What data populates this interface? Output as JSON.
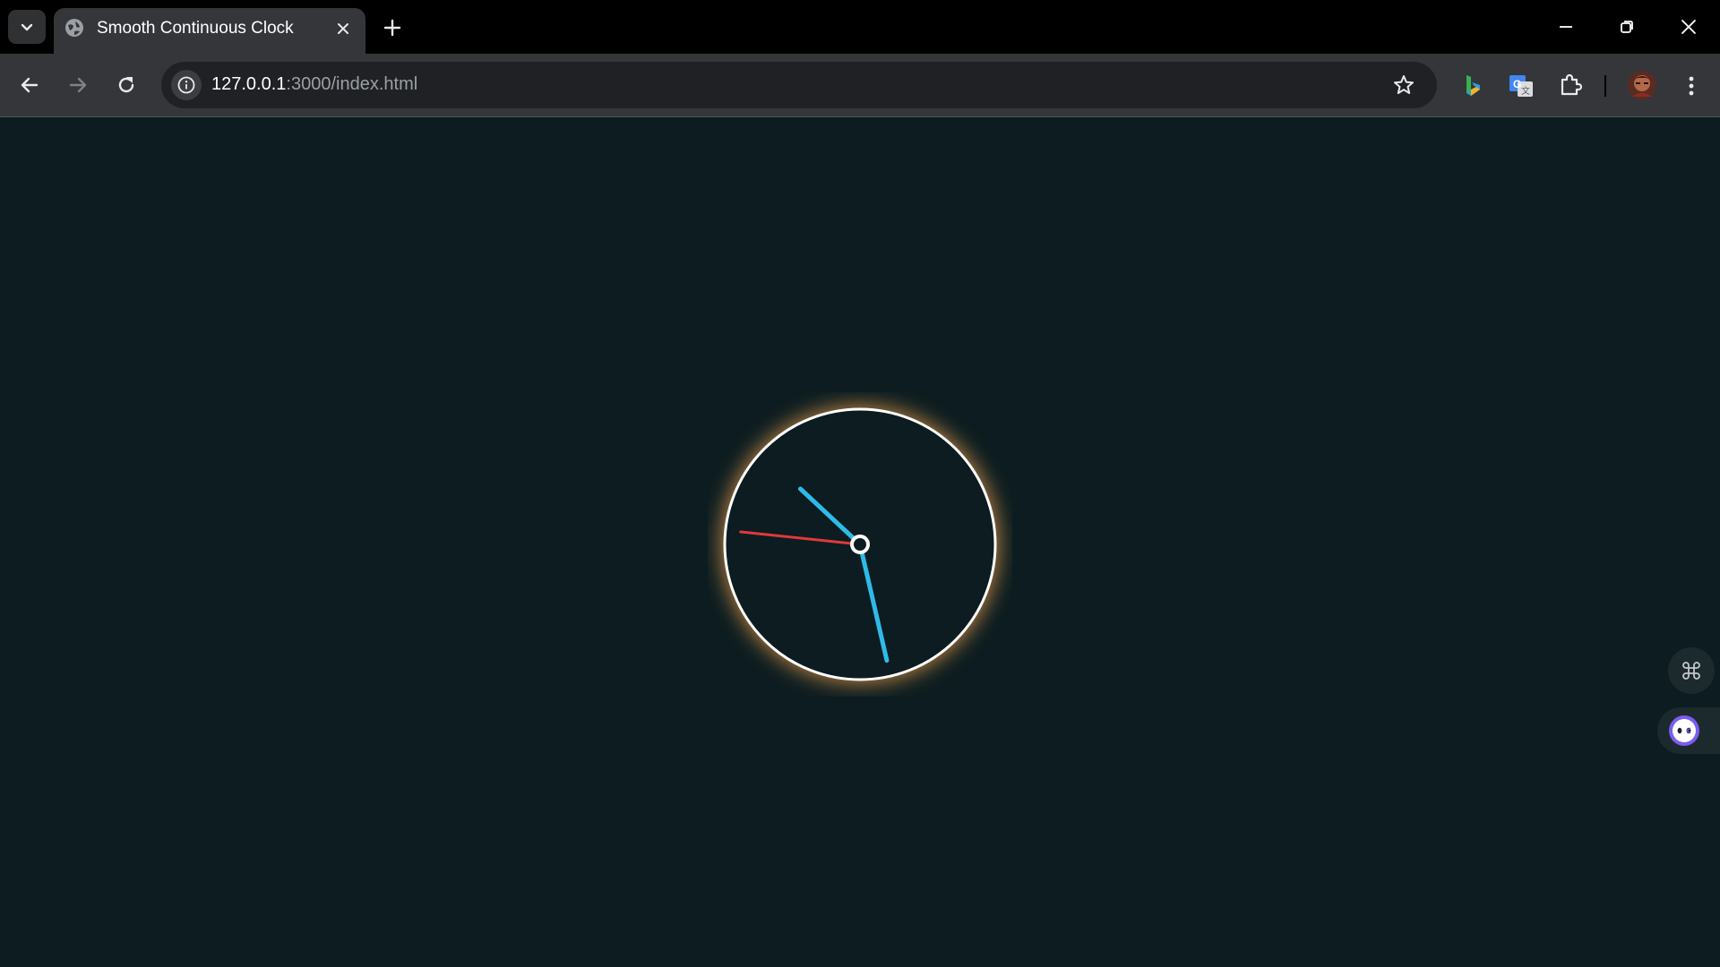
{
  "browser": {
    "tab_title": "Smooth Continuous Clock",
    "url_host": "127.0.0.1",
    "url_rest": ":3000/index.html"
  },
  "clock": {
    "hour_hand_angle_deg": 313,
    "minute_hand_angle_deg": 167,
    "second_hand_angle_deg": 276,
    "colors": {
      "background": "#0c1c20",
      "face": "#0c1c20",
      "rim": "#ffffff",
      "glow": "#d9944a",
      "hour_minute_hands": "#2ebbe8",
      "second_hand": "#e0393b"
    }
  },
  "icons": {
    "tab_search": "chevron-down-icon",
    "favicon": "globe-icon",
    "close": "close-icon",
    "new_tab": "plus-icon",
    "back": "arrow-left-icon",
    "forward": "arrow-right-icon",
    "reload": "reload-icon",
    "site_info": "info-icon",
    "bookmark": "star-icon",
    "extensions": [
      "bing-icon",
      "translate-icon",
      "puzzle-icon"
    ],
    "profile": "avatar",
    "menu": "kebab-menu-icon",
    "side_buttons": [
      "command-icon",
      "assistant-face-icon"
    ]
  }
}
